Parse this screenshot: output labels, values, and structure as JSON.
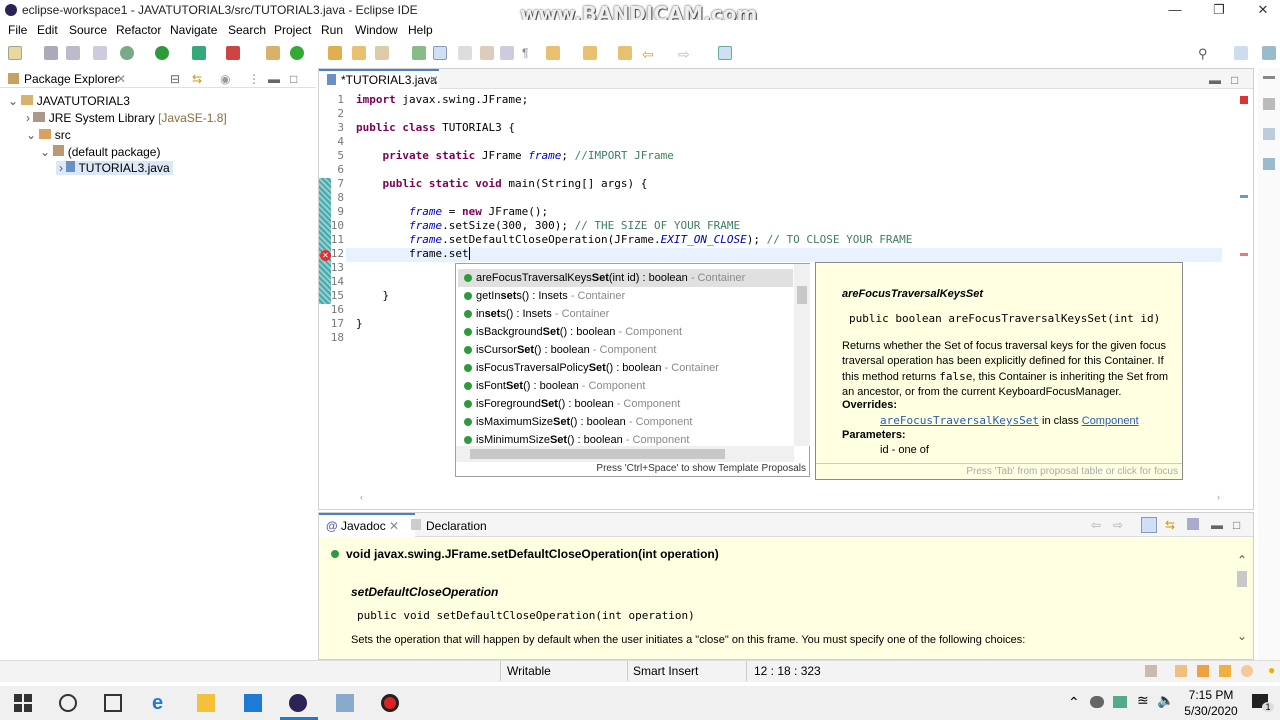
{
  "window": {
    "title": "eclipse-workspace1 - JAVATUTORIAL3/src/TUTORIAL3.java - Eclipse IDE",
    "watermark": "www.BANDICAM.com"
  },
  "menu": [
    "File",
    "Edit",
    "Source",
    "Refactor",
    "Navigate",
    "Search",
    "Project",
    "Run",
    "Window",
    "Help"
  ],
  "package_explorer": {
    "title": "Package Explorer",
    "items": [
      {
        "label": "JAVATUTORIAL3",
        "icon": "project-icon"
      },
      {
        "label": "JRE System Library",
        "suffix": "[JavaSE-1.8]",
        "icon": "library-icon"
      },
      {
        "label": "src",
        "icon": "source-folder-icon"
      },
      {
        "label": "(default package)",
        "icon": "package-icon"
      },
      {
        "label": "TUTORIAL3.java",
        "icon": "java-file-icon"
      }
    ]
  },
  "editor": {
    "tab": "*TUTORIAL3.java",
    "line_numbers": [
      "1",
      "2",
      "3",
      "4",
      "5",
      "6",
      "7",
      "8",
      "9",
      "10",
      "11",
      "12",
      "13",
      "14",
      "15",
      "16",
      "17",
      "18"
    ],
    "code": {
      "l1a": "import",
      "l1b": " javax.swing.JFrame;",
      "l3a": "public class",
      "l3b": " TUTORIAL3 {",
      "l5a": "    private static",
      "l5b": " JFrame ",
      "l5c": "frame",
      "l5d": "; ",
      "l5e": "//IMPORT JFrame",
      "l7a": "    public static void",
      "l7b": " main(String[] args) {",
      "l9a": "        ",
      "l9b": "frame",
      "l9c": " = ",
      "l9d": "new",
      "l9e": " JFrame();",
      "l10a": "        ",
      "l10b": "frame",
      "l10c": ".setSize(300, 300); ",
      "l10d": "// THE SIZE OF YOUR FRAME",
      "l11a": "        ",
      "l11b": "frame",
      "l11c": ".setDefaultCloseOperation(JFrame.",
      "l11d": "EXIT_ON_CLOSE",
      "l11e": "); ",
      "l11f": "// TO CLOSE YOUR FRAME",
      "l12": "        frame.set",
      "l15": "    }",
      "l17": "}"
    }
  },
  "completion": {
    "items": [
      {
        "pre": "areFocusTraversalKeys",
        "b": "Set",
        "post": "(int id) : boolean",
        "q": " - Container"
      },
      {
        "pre": "getIn",
        "b": "set",
        "post": "s() : Insets",
        "q": " - Container"
      },
      {
        "pre": "in",
        "b": "set",
        "post": "s() : Insets",
        "q": " - Container"
      },
      {
        "pre": "isBackground",
        "b": "Set",
        "post": "() : boolean",
        "q": " - Component"
      },
      {
        "pre": "isCursor",
        "b": "Set",
        "post": "() : boolean",
        "q": " - Component"
      },
      {
        "pre": "isFocusTraversalPolicy",
        "b": "Set",
        "post": "() : boolean",
        "q": " - Container"
      },
      {
        "pre": "isFont",
        "b": "Set",
        "post": "() : boolean",
        "q": " - Component"
      },
      {
        "pre": "isForeground",
        "b": "Set",
        "post": "() : boolean",
        "q": " - Component"
      },
      {
        "pre": "isMaximumSize",
        "b": "Set",
        "post": "() : boolean",
        "q": " - Component"
      },
      {
        "pre": "isMinimumSize",
        "b": "Set",
        "post": "() : boolean",
        "q": " - Component"
      }
    ],
    "footer": "Press 'Ctrl+Space' to show Template Proposals"
  },
  "doc_popup": {
    "title": "areFocusTraversalKeysSet",
    "signature": "public boolean areFocusTraversalKeysSet(int id)",
    "desc1": "Returns whether the Set of focus traversal keys for the given focus traversal operation has been explicitly defined for this Container. If this method returns ",
    "desc_code": "false",
    "desc2": ", this Container is inheriting the Set from an ancestor, or from the current KeyboardFocusManager.",
    "overrides_label": "Overrides:",
    "overrides_link": "areFocusTraversalKeysSet",
    "overrides_mid": " in class ",
    "overrides_class": "Component",
    "params_label": "Parameters:",
    "param": "id - one of",
    "footer": "Press 'Tab' from proposal table or click for focus"
  },
  "bottom": {
    "tabs": [
      "Javadoc",
      "Declaration"
    ],
    "heading": "void javax.swing.JFrame.setDefaultCloseOperation(int operation)",
    "name": "setDefaultCloseOperation",
    "signature": "public void setDefaultCloseOperation(int operation)",
    "text": "Sets the operation that will happen by default when the user initiates a \"close\" on this frame. You must specify one of the following choices:"
  },
  "status": {
    "writable": "Writable",
    "insert": "Smart Insert",
    "position": "12 : 18 : 323"
  },
  "taskbar": {
    "time": "7:15 PM",
    "date": "5/30/2020",
    "notifications": "1"
  }
}
